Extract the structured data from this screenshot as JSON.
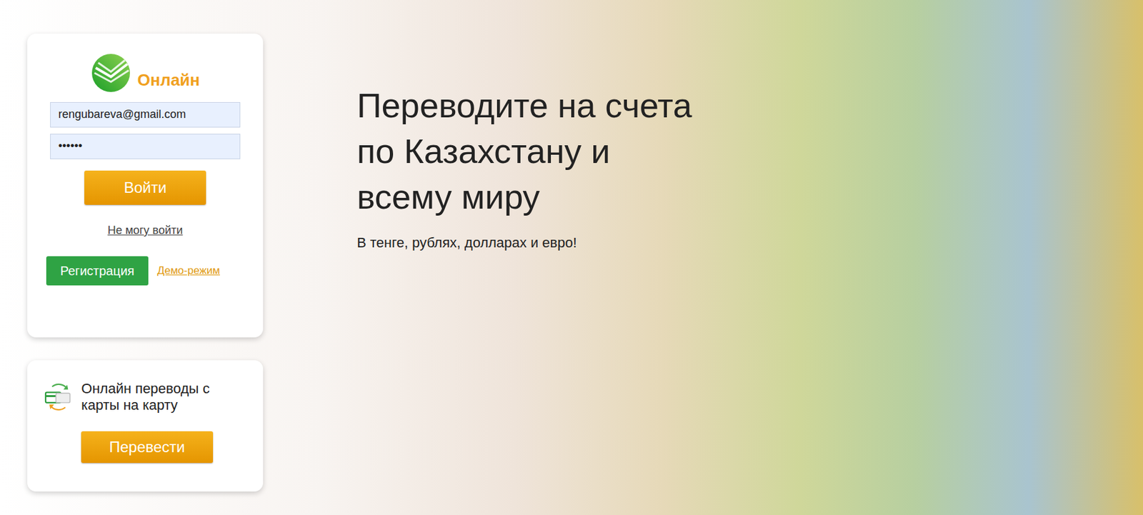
{
  "logo": {
    "label": "Онлайн"
  },
  "login": {
    "email": {
      "value": "rengubareva@gmail.com"
    },
    "password": {
      "value": "••••••"
    },
    "submit": "Войти",
    "help_link": "Не могу войти",
    "register": "Регистрация",
    "demo": "Демо-режим"
  },
  "transfer_card": {
    "title": "Онлайн переводы с карты на карту",
    "button": "Перевести"
  },
  "hero": {
    "heading": [
      "Переводите на счета",
      "по Казахстану и",
      "всему миру"
    ],
    "subtitle": "В тенге, рублях, долларах и евро!"
  }
}
